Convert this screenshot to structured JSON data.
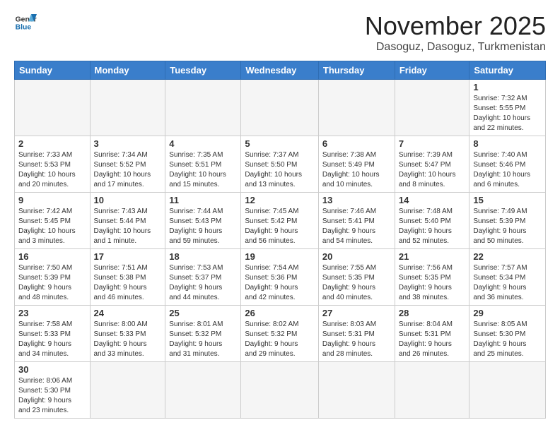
{
  "header": {
    "logo_line1": "General",
    "logo_line2": "Blue",
    "month_title": "November 2025",
    "location": "Dasoguz, Dasoguz, Turkmenistan"
  },
  "weekdays": [
    "Sunday",
    "Monday",
    "Tuesday",
    "Wednesday",
    "Thursday",
    "Friday",
    "Saturday"
  ],
  "weeks": [
    [
      {
        "day": "",
        "info": ""
      },
      {
        "day": "",
        "info": ""
      },
      {
        "day": "",
        "info": ""
      },
      {
        "day": "",
        "info": ""
      },
      {
        "day": "",
        "info": ""
      },
      {
        "day": "",
        "info": ""
      },
      {
        "day": "1",
        "info": "Sunrise: 7:32 AM\nSunset: 5:55 PM\nDaylight: 10 hours\nand 22 minutes."
      }
    ],
    [
      {
        "day": "2",
        "info": "Sunrise: 7:33 AM\nSunset: 5:53 PM\nDaylight: 10 hours\nand 20 minutes."
      },
      {
        "day": "3",
        "info": "Sunrise: 7:34 AM\nSunset: 5:52 PM\nDaylight: 10 hours\nand 17 minutes."
      },
      {
        "day": "4",
        "info": "Sunrise: 7:35 AM\nSunset: 5:51 PM\nDaylight: 10 hours\nand 15 minutes."
      },
      {
        "day": "5",
        "info": "Sunrise: 7:37 AM\nSunset: 5:50 PM\nDaylight: 10 hours\nand 13 minutes."
      },
      {
        "day": "6",
        "info": "Sunrise: 7:38 AM\nSunset: 5:49 PM\nDaylight: 10 hours\nand 10 minutes."
      },
      {
        "day": "7",
        "info": "Sunrise: 7:39 AM\nSunset: 5:47 PM\nDaylight: 10 hours\nand 8 minutes."
      },
      {
        "day": "8",
        "info": "Sunrise: 7:40 AM\nSunset: 5:46 PM\nDaylight: 10 hours\nand 6 minutes."
      }
    ],
    [
      {
        "day": "9",
        "info": "Sunrise: 7:42 AM\nSunset: 5:45 PM\nDaylight: 10 hours\nand 3 minutes."
      },
      {
        "day": "10",
        "info": "Sunrise: 7:43 AM\nSunset: 5:44 PM\nDaylight: 10 hours\nand 1 minute."
      },
      {
        "day": "11",
        "info": "Sunrise: 7:44 AM\nSunset: 5:43 PM\nDaylight: 9 hours\nand 59 minutes."
      },
      {
        "day": "12",
        "info": "Sunrise: 7:45 AM\nSunset: 5:42 PM\nDaylight: 9 hours\nand 56 minutes."
      },
      {
        "day": "13",
        "info": "Sunrise: 7:46 AM\nSunset: 5:41 PM\nDaylight: 9 hours\nand 54 minutes."
      },
      {
        "day": "14",
        "info": "Sunrise: 7:48 AM\nSunset: 5:40 PM\nDaylight: 9 hours\nand 52 minutes."
      },
      {
        "day": "15",
        "info": "Sunrise: 7:49 AM\nSunset: 5:39 PM\nDaylight: 9 hours\nand 50 minutes."
      }
    ],
    [
      {
        "day": "16",
        "info": "Sunrise: 7:50 AM\nSunset: 5:39 PM\nDaylight: 9 hours\nand 48 minutes."
      },
      {
        "day": "17",
        "info": "Sunrise: 7:51 AM\nSunset: 5:38 PM\nDaylight: 9 hours\nand 46 minutes."
      },
      {
        "day": "18",
        "info": "Sunrise: 7:53 AM\nSunset: 5:37 PM\nDaylight: 9 hours\nand 44 minutes."
      },
      {
        "day": "19",
        "info": "Sunrise: 7:54 AM\nSunset: 5:36 PM\nDaylight: 9 hours\nand 42 minutes."
      },
      {
        "day": "20",
        "info": "Sunrise: 7:55 AM\nSunset: 5:35 PM\nDaylight: 9 hours\nand 40 minutes."
      },
      {
        "day": "21",
        "info": "Sunrise: 7:56 AM\nSunset: 5:35 PM\nDaylight: 9 hours\nand 38 minutes."
      },
      {
        "day": "22",
        "info": "Sunrise: 7:57 AM\nSunset: 5:34 PM\nDaylight: 9 hours\nand 36 minutes."
      }
    ],
    [
      {
        "day": "23",
        "info": "Sunrise: 7:58 AM\nSunset: 5:33 PM\nDaylight: 9 hours\nand 34 minutes."
      },
      {
        "day": "24",
        "info": "Sunrise: 8:00 AM\nSunset: 5:33 PM\nDaylight: 9 hours\nand 33 minutes."
      },
      {
        "day": "25",
        "info": "Sunrise: 8:01 AM\nSunset: 5:32 PM\nDaylight: 9 hours\nand 31 minutes."
      },
      {
        "day": "26",
        "info": "Sunrise: 8:02 AM\nSunset: 5:32 PM\nDaylight: 9 hours\nand 29 minutes."
      },
      {
        "day": "27",
        "info": "Sunrise: 8:03 AM\nSunset: 5:31 PM\nDaylight: 9 hours\nand 28 minutes."
      },
      {
        "day": "28",
        "info": "Sunrise: 8:04 AM\nSunset: 5:31 PM\nDaylight: 9 hours\nand 26 minutes."
      },
      {
        "day": "29",
        "info": "Sunrise: 8:05 AM\nSunset: 5:30 PM\nDaylight: 9 hours\nand 25 minutes."
      }
    ],
    [
      {
        "day": "30",
        "info": "Sunrise: 8:06 AM\nSunset: 5:30 PM\nDaylight: 9 hours\nand 23 minutes."
      },
      {
        "day": "",
        "info": ""
      },
      {
        "day": "",
        "info": ""
      },
      {
        "day": "",
        "info": ""
      },
      {
        "day": "",
        "info": ""
      },
      {
        "day": "",
        "info": ""
      },
      {
        "day": "",
        "info": ""
      }
    ]
  ]
}
